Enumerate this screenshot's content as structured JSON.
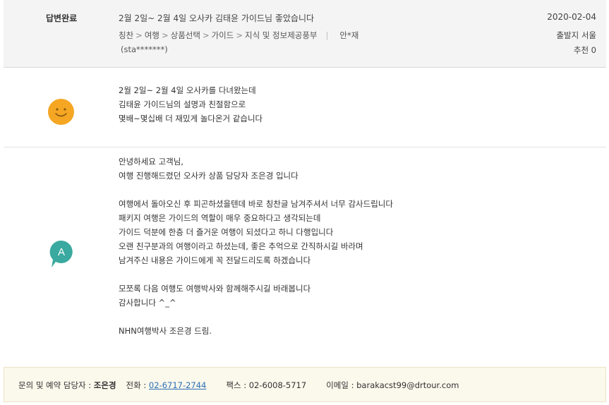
{
  "header": {
    "status": "답변완료",
    "title": "2월 2일~ 2월 4일 오사카 김태윤 가이드님 좋았습니다",
    "date": "2020-02-04",
    "breadcrumbs": [
      "칭찬",
      "여행",
      "상품선택",
      "가이드",
      "지식 및 정보제공풍부"
    ],
    "author": "안*재",
    "user_id": "(sta*******)",
    "departure": "출발지 서울",
    "recommend": "추천 0"
  },
  "review": {
    "icon": "smiley-icon",
    "lines": [
      "2월 2일~ 2월 4일 오사카를 다녀왔는데",
      "김태윤 가이드님의 설명과 친절함으로",
      "몇배~몇십배 더 재밌게 놀다온거 같습니다"
    ]
  },
  "answer": {
    "avatar_letter": "A",
    "lines": [
      "안녕하세요 고객님,",
      "여행 진행해드렸던 오사카 상품 담당자 조은경 입니다",
      "",
      "여행에서 돌아오신 후 피곤하셨을텐데 바로 칭찬글 남겨주셔서 너무 감사드립니다",
      "패키지 여행은 가이드의 역할이 매우 중요하다고 생각되는데",
      "가이드 덕분에 한층 더 즐거운 여행이 되셨다고 하니 다행입니다",
      "오랜 친구분과의 여행이라고 하셨는데, 좋은 추억으로 간직하시길 바라며",
      "남겨주신 내용은 가이드에게 꼭 전달드리도록 하겠습니다",
      "",
      "모쪼록 다음 여행도 여행박사와 함께해주시길 바래봅니다",
      "감사합니다 ^_^",
      "",
      "NHN여행박사 조은경 드림."
    ]
  },
  "contact": {
    "label": "문의 및 예약 담당자 : ",
    "name": "조은경",
    "phone_label": "전화 : ",
    "phone": "02-6717-2744",
    "fax": "팩스 : 02-6008-5717",
    "email": "이메일 : barakacst99@drtour.com"
  },
  "colors": {
    "smiley": "#f5a623",
    "avatar": "#3aa99f",
    "link": "#2a6fb5"
  }
}
